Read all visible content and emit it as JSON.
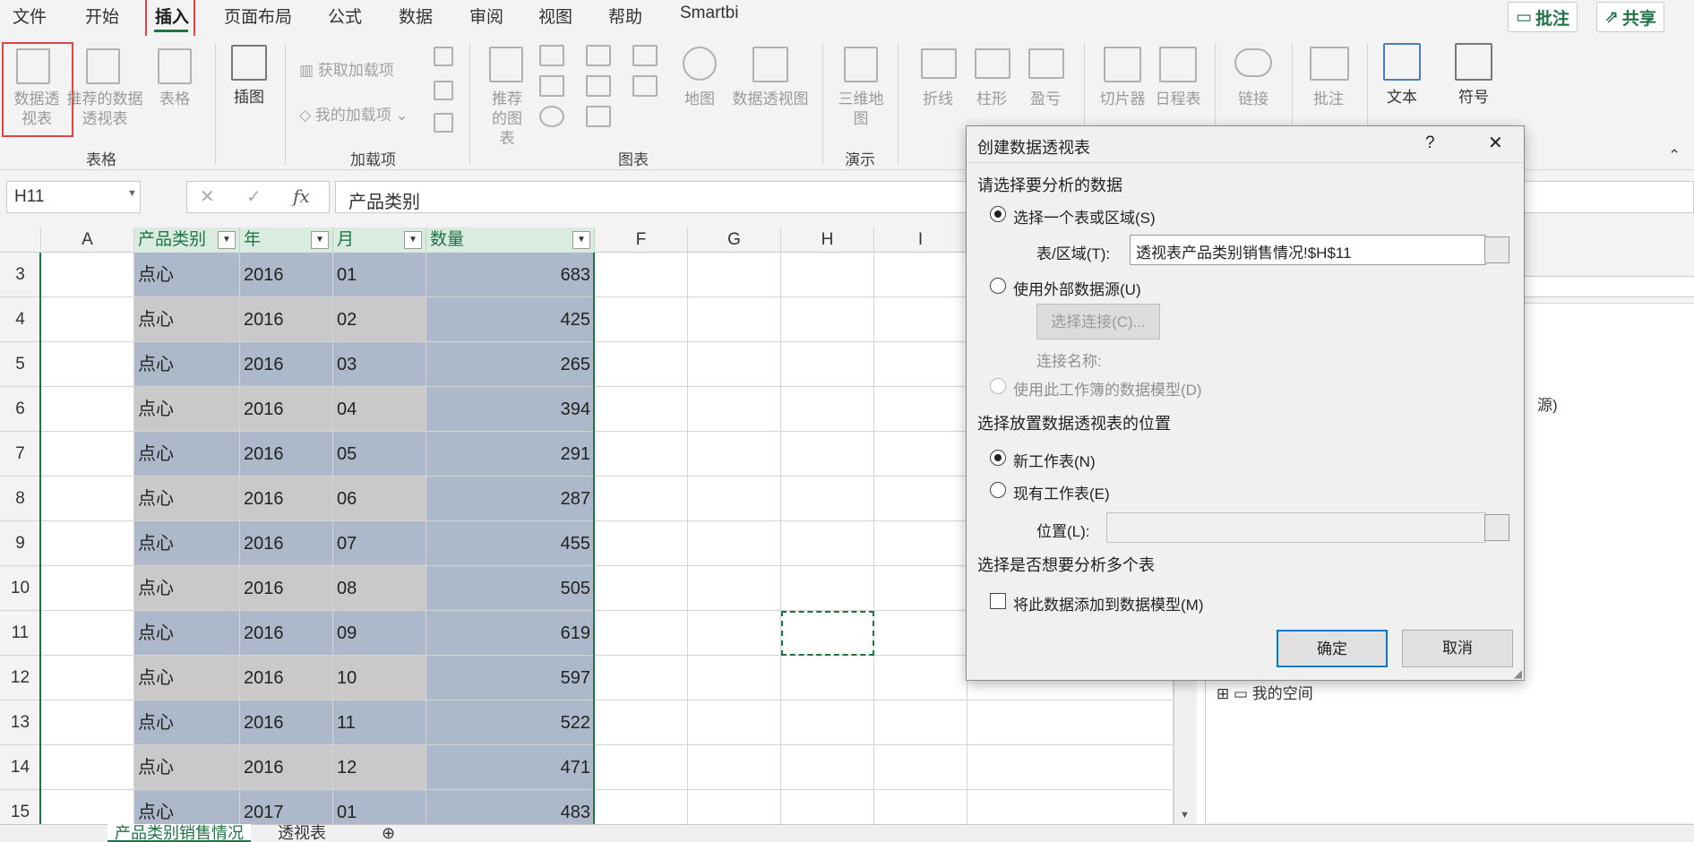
{
  "menu": {
    "tabs": [
      "文件",
      "开始",
      "插入",
      "页面布局",
      "公式",
      "数据",
      "审阅",
      "视图",
      "帮助",
      "Smartbi"
    ],
    "active_tab": "插入",
    "comments_btn": "批注",
    "share_btn": "共享"
  },
  "ribbon": {
    "pivot_table": "数据透视表",
    "recommended_pivot": "推荐的数据透视表",
    "table": "表格",
    "group_tables": "表格",
    "illustrations": "插图",
    "get_addins": "获取加载项",
    "my_addins": "我的加载项",
    "group_addins": "加载项",
    "recommended_charts": "推荐的图表",
    "map": "地图",
    "pivot_chart": "数据透视图",
    "group_charts": "图表",
    "map3d": "三维地图",
    "group_tours": "演示",
    "line": "折线",
    "column": "柱形",
    "winloss": "盈亏",
    "slicer": "切片器",
    "timeline": "日程表",
    "link": "链接",
    "comment": "批注",
    "text": "文本",
    "symbol": "符号"
  },
  "formula_bar": {
    "name_box": "H11",
    "fx": "fx",
    "content": "产品类别"
  },
  "grid": {
    "columns": [
      "A",
      "产品类别",
      "年",
      "月",
      "数量",
      "F",
      "G",
      "H",
      "I"
    ],
    "rows": [
      {
        "n": "3",
        "cat": "点心",
        "year": "2016",
        "month": "01",
        "qty": "683"
      },
      {
        "n": "4",
        "cat": "点心",
        "year": "2016",
        "month": "02",
        "qty": "425"
      },
      {
        "n": "5",
        "cat": "点心",
        "year": "2016",
        "month": "03",
        "qty": "265"
      },
      {
        "n": "6",
        "cat": "点心",
        "year": "2016",
        "month": "04",
        "qty": "394"
      },
      {
        "n": "7",
        "cat": "点心",
        "year": "2016",
        "month": "05",
        "qty": "291"
      },
      {
        "n": "8",
        "cat": "点心",
        "year": "2016",
        "month": "06",
        "qty": "287"
      },
      {
        "n": "9",
        "cat": "点心",
        "year": "2016",
        "month": "07",
        "qty": "455"
      },
      {
        "n": "10",
        "cat": "点心",
        "year": "2016",
        "month": "08",
        "qty": "505"
      },
      {
        "n": "11",
        "cat": "点心",
        "year": "2016",
        "month": "09",
        "qty": "619"
      },
      {
        "n": "12",
        "cat": "点心",
        "year": "2016",
        "month": "10",
        "qty": "597"
      },
      {
        "n": "13",
        "cat": "点心",
        "year": "2016",
        "month": "11",
        "qty": "522"
      },
      {
        "n": "14",
        "cat": "点心",
        "year": "2016",
        "month": "12",
        "qty": "471"
      },
      {
        "n": "15",
        "cat": "点心",
        "year": "2017",
        "month": "01",
        "qty": "483"
      }
    ]
  },
  "sheets": [
    "产品类别销售情况",
    "透视表"
  ],
  "sidepane": {
    "partial_text": "源)",
    "tree_item": "我的空间"
  },
  "dialog": {
    "title": "创建数据透视表",
    "help": "?",
    "section1": "请选择要分析的数据",
    "opt_table": "选择一个表或区域(S)",
    "range_label": "表/区域(T):",
    "range_value": "透视表产品类别销售情况!$H$11",
    "opt_external": "使用外部数据源(U)",
    "choose_conn": "选择连接(C)...",
    "conn_name": "连接名称:",
    "opt_model": "使用此工作簿的数据模型(D)",
    "section2": "选择放置数据透视表的位置",
    "opt_new": "新工作表(N)",
    "opt_existing": "现有工作表(E)",
    "location_label": "位置(L):",
    "location_value": "",
    "section3": "选择是否想要分析多个表",
    "add_model": "将此数据添加到数据模型(M)",
    "ok": "确定",
    "cancel": "取消"
  }
}
